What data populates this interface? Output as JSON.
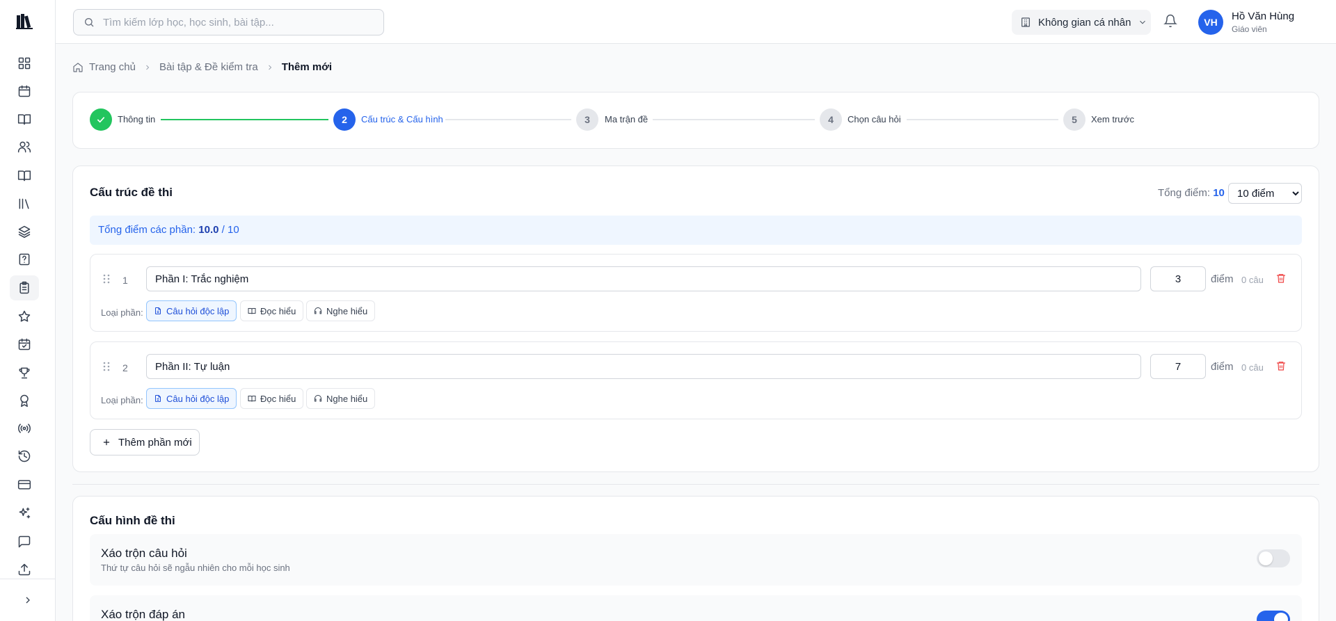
{
  "search": {
    "placeholder": "Tìm kiếm lớp học, học sinh, bài tập..."
  },
  "header": {
    "workspace_label": "Không gian cá nhân",
    "user": {
      "initials": "VH",
      "name": "Hồ Văn Hùng",
      "role": "Giáo viên"
    }
  },
  "breadcrumb": {
    "home": "Trang chủ",
    "section": "Bài tập & Đề kiểm tra",
    "current": "Thêm mới"
  },
  "stepper": {
    "steps": [
      {
        "number": "1",
        "label": "Thông tin",
        "status": "done"
      },
      {
        "number": "2",
        "label": "Cấu trúc & Cấu hình",
        "status": "active"
      },
      {
        "number": "3",
        "label": "Ma trận đề",
        "status": "todo"
      },
      {
        "number": "4",
        "label": "Chọn câu hỏi",
        "status": "todo"
      },
      {
        "number": "5",
        "label": "Xem trước",
        "status": "todo"
      }
    ]
  },
  "structure": {
    "title": "Cấu trúc đề thi",
    "total_label": "Tổng điểm:",
    "total_value": "10",
    "total_select": "10 điểm",
    "sum_label": "Tổng điểm các phần:",
    "sum_value": "10.0",
    "sum_max": "/ 10",
    "type_label": "Loại phần:",
    "type_options": [
      "Câu hỏi độc lập",
      "Đọc hiểu",
      "Nghe hiểu"
    ],
    "score_unit": "điểm",
    "parts": [
      {
        "number": "1",
        "name": "Phần I: Trắc nghiệm",
        "score": "3",
        "count": "0 câu",
        "selected_type": "Câu hỏi độc lập"
      },
      {
        "number": "2",
        "name": "Phần II: Tự luận",
        "score": "7",
        "count": "0 câu",
        "selected_type": "Câu hỏi độc lập"
      }
    ],
    "add_label": "Thêm phần mới"
  },
  "config": {
    "title": "Cấu hình đề thi",
    "options": [
      {
        "title": "Xáo trộn câu hỏi",
        "desc": "Thứ tự câu hỏi sẽ ngẫu nhiên cho mỗi học sinh",
        "enabled": false
      },
      {
        "title": "Xáo trộn đáp án",
        "desc": "",
        "enabled": true
      }
    ]
  },
  "colors": {
    "accent": "#2563eb",
    "success": "#22c55e",
    "danger": "#ef4444"
  }
}
